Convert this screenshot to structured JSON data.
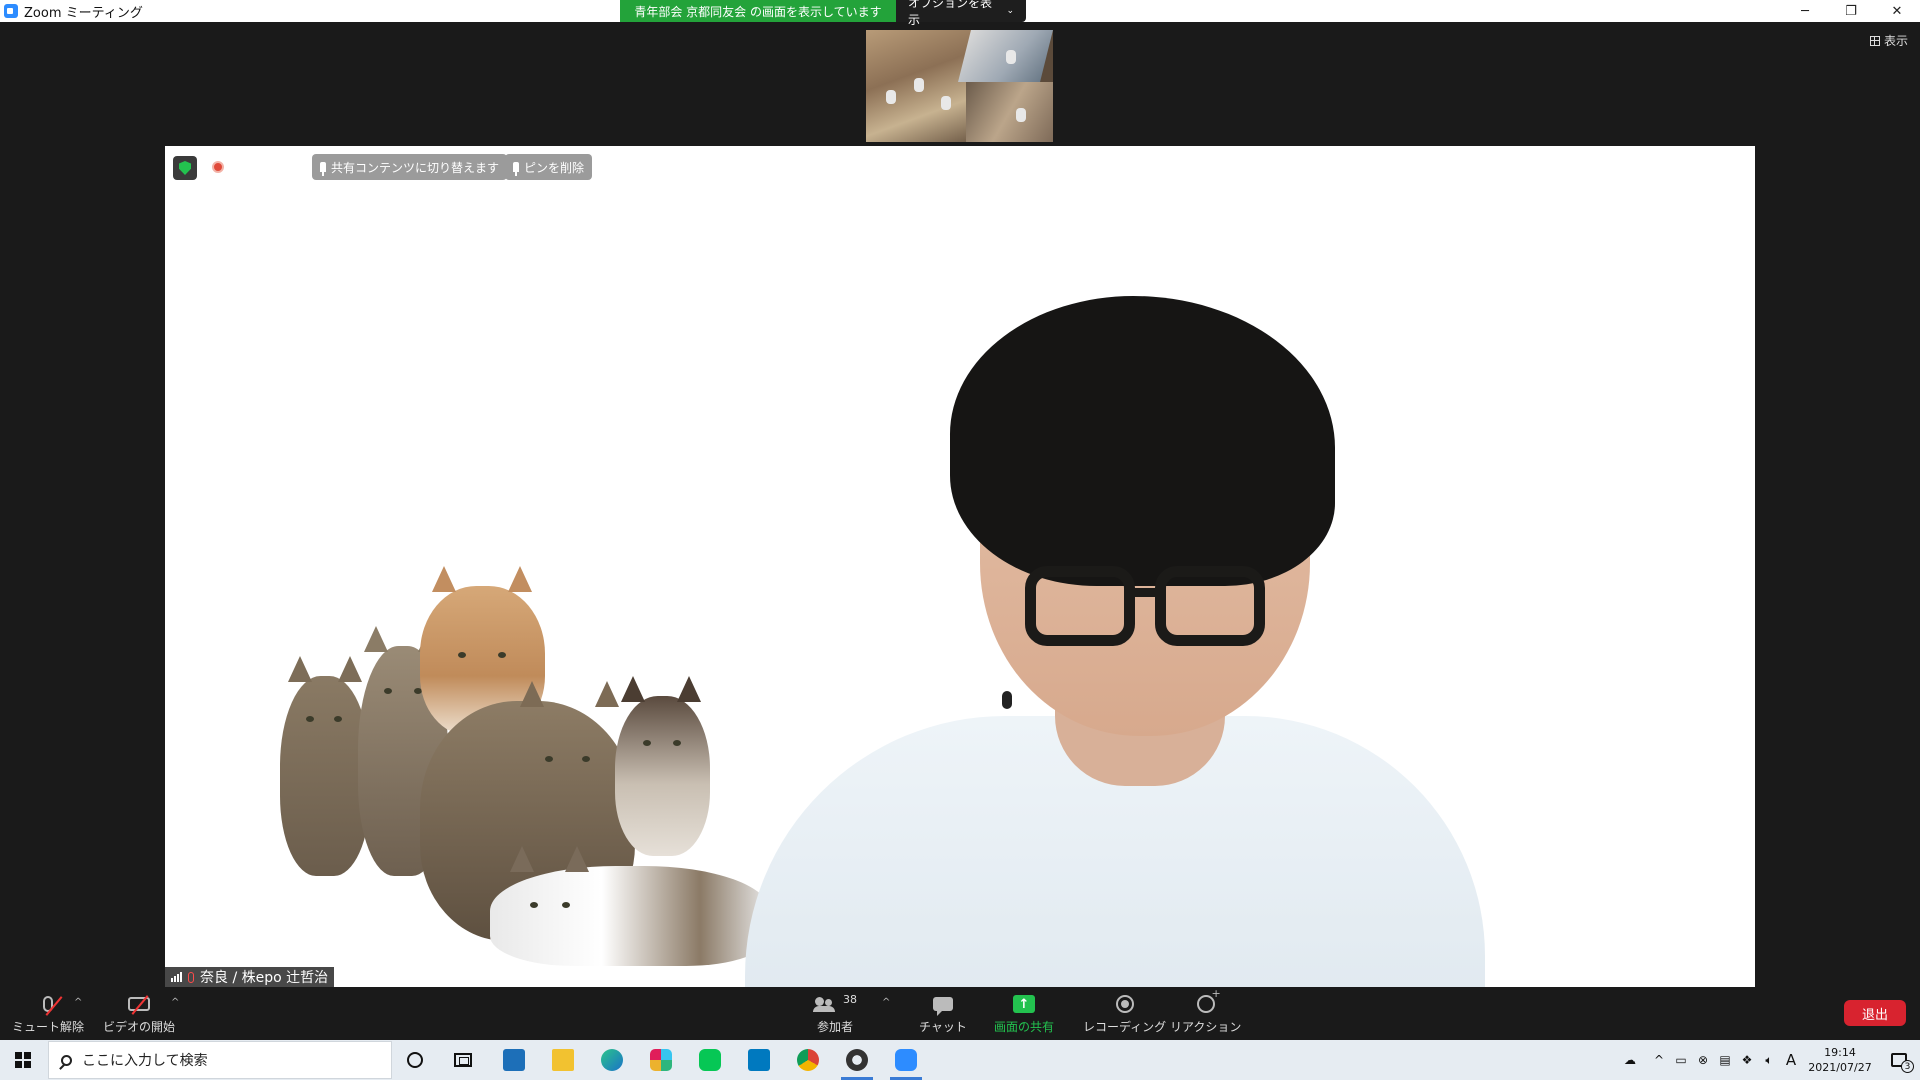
{
  "window": {
    "title": "Zoom ミーティング",
    "share_banner": "青年部会 京都同友会 の画面を表示しています",
    "options_label": "オプションを表示",
    "controls": {
      "minimize": "─",
      "restore": "❐",
      "close": "✕"
    }
  },
  "view_button": "表示",
  "main": {
    "switch_share_label": "共有コンテンツに切り替えます",
    "remove_pin_label": "ピンを削除",
    "participant_name": "奈良 / 株epo 辻哲治"
  },
  "toolbar": {
    "unmute_label": "ミュート解除",
    "start_video_label": "ビデオの開始",
    "participants_label": "参加者",
    "participants_count": "38",
    "chat_label": "チャット",
    "share_label": "画面の共有",
    "recording_label": "レコーディング",
    "reactions_label": "リアクション",
    "leave_label": "退出",
    "colors": {
      "share_green": "#23c24f",
      "leave_red": "#d8232f"
    }
  },
  "taskbar": {
    "search_placeholder": "ここに入力して検索",
    "ime_indicator": "A",
    "time": "19:14",
    "date": "2021/07/27",
    "notification_count": "3",
    "apps": [
      "cortana-icon",
      "task-view-icon",
      "dreamweaver-icon",
      "file-explorer-icon",
      "edge-icon",
      "slack-icon",
      "line-icon",
      "trello-icon",
      "chrome-icon",
      "settings-icon",
      "zoom-icon"
    ]
  }
}
